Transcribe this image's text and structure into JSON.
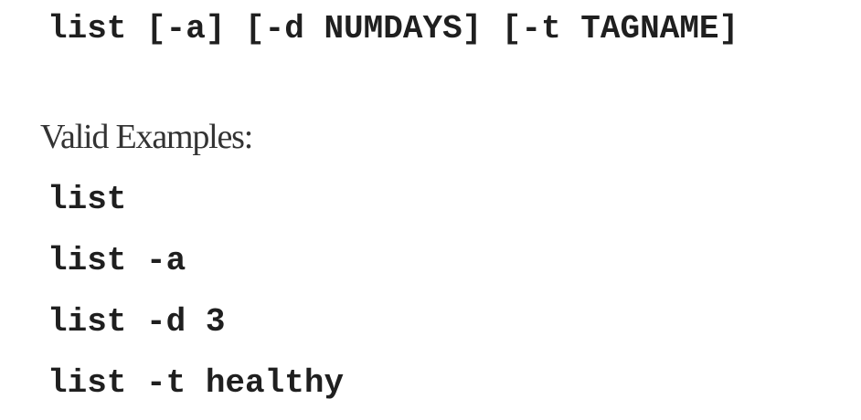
{
  "usage": "list [-a] [-d NUMDAYS] [-t TAGNAME]",
  "examples_heading": "Valid Examples:",
  "examples": [
    "list",
    "list -a",
    "list -d 3",
    "list -t healthy"
  ]
}
